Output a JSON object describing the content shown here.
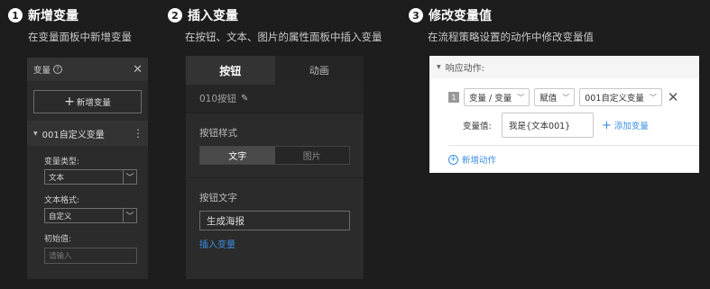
{
  "steps": [
    {
      "num": "1",
      "title": "新增变量",
      "subtitle": "在变量面板中新增变量"
    },
    {
      "num": "2",
      "title": "插入变量",
      "subtitle": "在按钮、文本、图片的属性面板中插入变量"
    },
    {
      "num": "3",
      "title": "修改变量值",
      "subtitle": "在流程策略设置的动作中修改变量值"
    }
  ],
  "variable_panel": {
    "title": "变量",
    "add_button": "新增变量",
    "variable_name": "001自定义变量",
    "type_label": "变量类型:",
    "type_value": "文本",
    "format_label": "文本格式:",
    "format_value": "自定义",
    "initial_label": "初始值:",
    "initial_placeholder": "请输入"
  },
  "button_panel": {
    "tabs": [
      "按钮",
      "动画"
    ],
    "active_tab": "按钮",
    "element_name": "010按钮",
    "style_label": "按钮样式",
    "style_options": [
      "文字",
      "图片"
    ],
    "style_selected": "文字",
    "text_label": "按钮文字",
    "text_value": "生成海报",
    "insert_link": "插入变量"
  },
  "action_panel": {
    "header": "响应动作:",
    "index": "1",
    "action_type": "变量 / 变量",
    "operation": "赋值",
    "target_variable": "001自定义变量",
    "value_label": "变量值:",
    "value_text": "我是{文本001}",
    "add_variable": "添加变量",
    "new_action": "新增动作"
  },
  "colors": {
    "background": "#1d1d1d",
    "panel": "#2b2b2b",
    "link": "#3a8ee6"
  }
}
